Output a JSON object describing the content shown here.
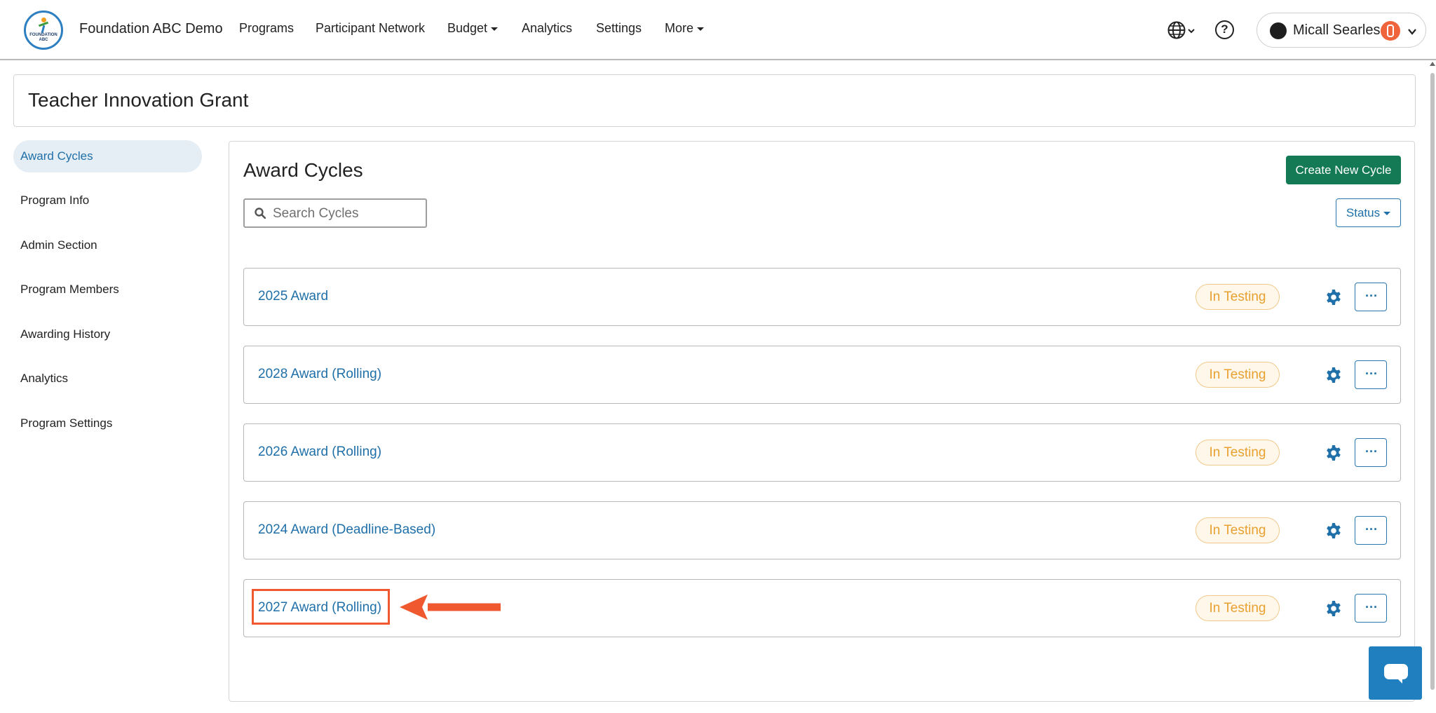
{
  "header": {
    "brand": "Foundation ABC Demo",
    "logo_text": "FOUNDATION ABC",
    "nav": [
      {
        "label": "Programs"
      },
      {
        "label": "Participant Network"
      },
      {
        "label": "Budget"
      },
      {
        "label": "Analytics"
      },
      {
        "label": "Settings"
      },
      {
        "label": "More"
      }
    ],
    "help_glyph": "?",
    "user_name": "Micall Searles"
  },
  "page_title": "Teacher Innovation Grant",
  "sidebar": {
    "items": [
      {
        "label": "Award Cycles",
        "active": true
      },
      {
        "label": "Program Info"
      },
      {
        "label": "Admin Section"
      },
      {
        "label": "Program Members"
      },
      {
        "label": "Awarding History"
      },
      {
        "label": "Analytics"
      },
      {
        "label": "Program Settings"
      }
    ]
  },
  "main": {
    "title": "Award Cycles",
    "create_label": "Create New Cycle",
    "search_placeholder": "Search Cycles",
    "status_label": "Status",
    "cycles": [
      {
        "name": "2025 Award",
        "status": "In Testing",
        "more": "···"
      },
      {
        "name": "2028 Award (Rolling)",
        "status": "In Testing",
        "more": "···"
      },
      {
        "name": "2026 Award (Rolling)",
        "status": "In Testing",
        "more": "···"
      },
      {
        "name": "2024 Award (Deadline-Based)",
        "status": "In Testing",
        "more": "···"
      },
      {
        "name": "2027 Award (Rolling)",
        "status": "In Testing",
        "more": "···"
      }
    ]
  },
  "colors": {
    "accent_link": "#1f6fa8",
    "create_button": "#147a56",
    "status_pill_text": "#e8a030",
    "annotation": "#f0582f",
    "chat_button": "#1f7fbf"
  }
}
